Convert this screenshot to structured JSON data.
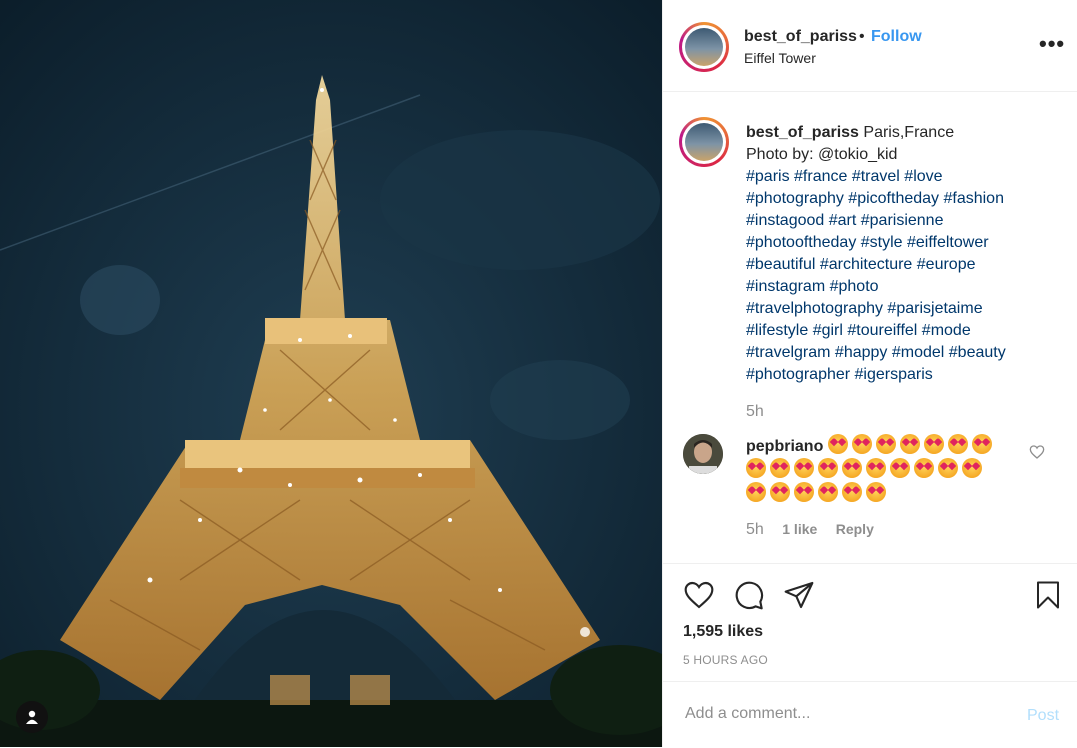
{
  "post": {
    "image_alt": "Eiffel Tower illuminated at night",
    "header": {
      "username": "best_of_pariss",
      "separator": "•",
      "follow_label": "Follow",
      "location": "Eiffel Tower",
      "more_icon": "more-options-icon"
    },
    "caption": {
      "username": "best_of_pariss",
      "line1": "Paris,France",
      "line2": "Photo by: @tokio_kid",
      "hashtag_lines": [
        "#paris #france #travel #love",
        "#photography #picoftheday #fashion",
        "#instagood #art #parisienne",
        "#photooftheday #style #eiffeltower",
        "#beautiful #architecture #europe",
        "#instagram #photo",
        "#travelphotography #parisjetaime",
        "#lifestyle #girl #toureiffel #mode",
        "#travelgram #happy #model #beauty",
        "#photographer #igersparis"
      ],
      "time": "5h"
    },
    "comment": {
      "username": "pepbriano",
      "emoji_rows": [
        7,
        10,
        6
      ],
      "emoji_name": "heart-eyes-emoji",
      "time": "5h",
      "likes": "1 like",
      "reply_label": "Reply"
    },
    "actions": {
      "like_icon": "heart-icon",
      "comment_icon": "comment-icon",
      "share_icon": "share-icon",
      "save_icon": "bookmark-icon"
    },
    "likes_text": "1,595 likes",
    "time_ago": "5 HOURS AGO",
    "add_comment": {
      "placeholder": "Add a comment...",
      "post_label": "Post"
    }
  },
  "colors": {
    "accent": "#3897f0",
    "hashtag": "#00376b",
    "muted": "#8e8e8e",
    "post_disabled": "#b2dffc"
  }
}
